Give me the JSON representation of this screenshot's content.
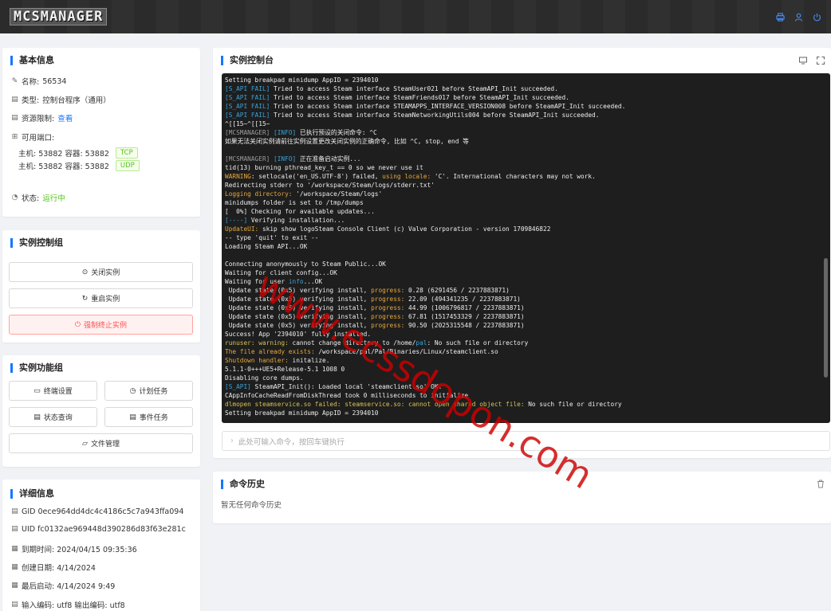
{
  "header": {
    "logo": "MCSMANAGER",
    "icons": [
      "printer-icon",
      "user-icon",
      "power-icon"
    ]
  },
  "basic_info": {
    "title": "基本信息",
    "name_label": "名称:",
    "name_value": "56534",
    "type_label": "类型:",
    "type_value": "控制台程序（通用）",
    "resource_label": "资源限制:",
    "resource_link": "查看",
    "ports_label": "可用端口:",
    "ports": [
      {
        "text": "主机: 53882  容器: 53882",
        "protocol": "TCP"
      },
      {
        "text": "主机: 53882  容器: 53882",
        "protocol": "UDP"
      }
    ],
    "status_label": "状态:",
    "status_value": "运行中"
  },
  "control_group": {
    "title": "实例控制组",
    "buttons": [
      "关闭实例",
      "重启实例",
      "强制终止实例"
    ]
  },
  "function_group": {
    "title": "实例功能组",
    "buttons": [
      "终端设置",
      "计划任务",
      "状态查询",
      "事件任务",
      "文件管理"
    ]
  },
  "details": {
    "title": "详细信息",
    "rows": [
      "GID 0ece964dd4dc4c4186c5c7a943ffa094",
      "UID fc0132ae969448d390286d83f63e281c",
      "到期时间: 2024/04/15 09:35:36",
      "创建日期: 4/14/2024",
      "最后启动: 4/14/2024 9:49",
      "输入编码: utf8 输出编码: utf8"
    ]
  },
  "console_panel": {
    "title": "实例控制台",
    "input_placeholder": "此处可输入命令，按回车键执行"
  },
  "history": {
    "title": "命令历史",
    "empty_text": "暂无任何命令历史"
  },
  "watermark": "www.ecssdopon.com",
  "colors": {
    "accent": "#1677ff",
    "success": "#52c41a",
    "danger": "#ff4d4f",
    "console_bg": "#1e1e1e"
  }
}
